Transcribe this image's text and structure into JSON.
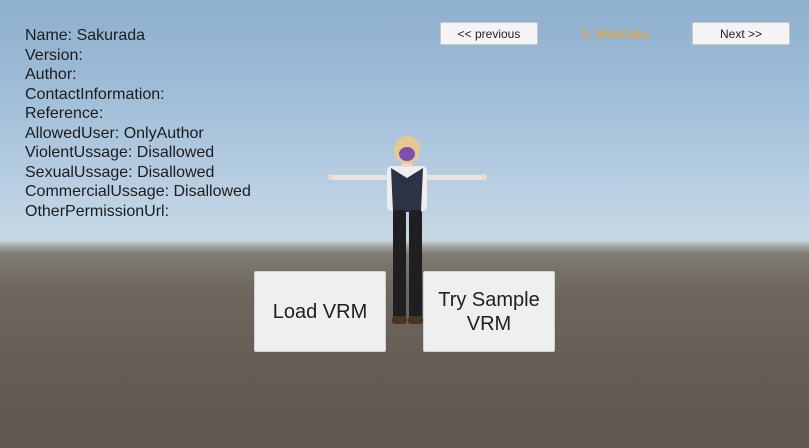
{
  "meta": {
    "name": "Name: Sakurada",
    "version": "Version:",
    "author": "Author:",
    "contact": "ContactInformation:",
    "reference": "Reference:",
    "allowed_user": "AllowedUser: OnlyAuthor",
    "violent": "ViolentUssage: Disallowed",
    "sexual": "SexualUssage: Disallowed",
    "commercial": "CommercialUssage: Disallowed",
    "other_permission": "OtherPermissionUrl:"
  },
  "nav": {
    "previous_label": "<< previous",
    "step_label": "5. MetaData",
    "next_label": "Next >>"
  },
  "actions": {
    "load_label": "Load VRM",
    "sample_label": "Try Sample VRM"
  },
  "colors": {
    "step_accent": "#f0a020"
  }
}
